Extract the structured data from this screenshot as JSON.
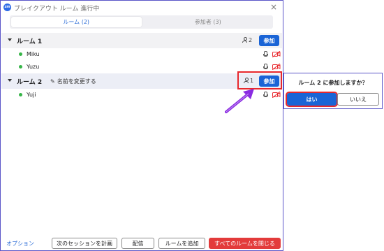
{
  "window": {
    "title": "ブレイクアウト ルーム  進行中",
    "logo": "zm"
  },
  "tabs": [
    {
      "label": "ルーム (2)",
      "active": true
    },
    {
      "label": "参加者 (3)",
      "active": false
    }
  ],
  "rooms": [
    {
      "name": "ルーム 1",
      "count": "2",
      "join_label": "参加",
      "members": [
        {
          "name": "Miku",
          "status_color": "#36b548"
        },
        {
          "name": "Yuzu",
          "status_color": "#36b548"
        }
      ]
    },
    {
      "name": "ルーム 2",
      "rename_label": "名前を変更する",
      "count": "1",
      "join_label": "参加",
      "members": [
        {
          "name": "Yuji",
          "status_color": "#36b548"
        }
      ]
    }
  ],
  "footer": {
    "options_label": "オプション",
    "plan_next_label": "次のセッションを計画",
    "assign_label": "配信",
    "add_room_label": "ルームを追加",
    "close_all_label": "すべてのルームを閉じる"
  },
  "popup": {
    "question": "ルーム 2 に参加しますか？",
    "yes_label": "はい",
    "no_label": "いいえ"
  },
  "colors": {
    "accent": "#1a64d6",
    "highlight": "#e8282d",
    "arrow": "#8a2be2",
    "close_all": "#e33b3b",
    "status_online": "#36b548",
    "video_off": "#e8282d"
  },
  "icons": {
    "pencil": "✎",
    "close": "×"
  }
}
